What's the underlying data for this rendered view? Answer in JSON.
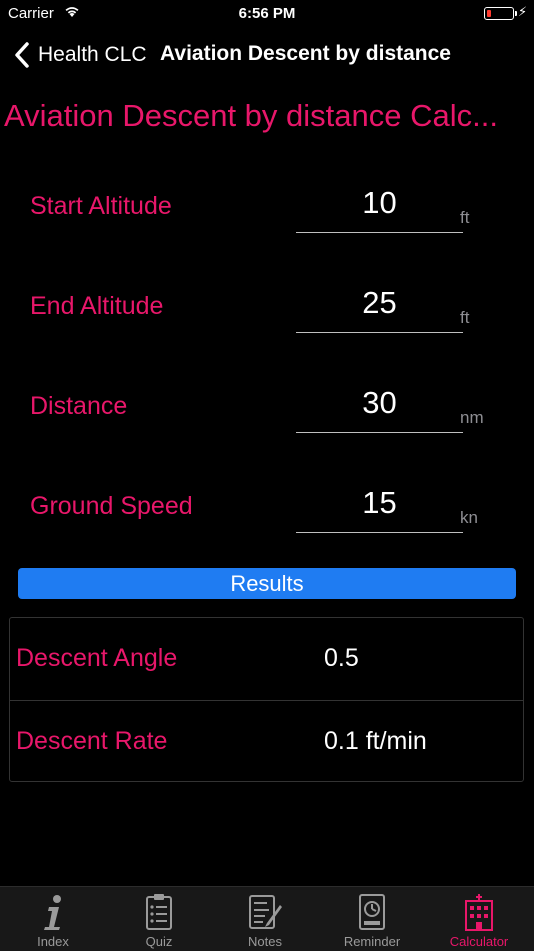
{
  "status_bar": {
    "carrier": "Carrier",
    "time": "6:56 PM",
    "charging_glyph": "⚡"
  },
  "nav": {
    "back_label": "Health CLC",
    "title": "Aviation Descent by distance"
  },
  "page_title": "Aviation Descent by distance Calc...",
  "fields": [
    {
      "label": "Start Altitude",
      "value": "10",
      "unit": "ft"
    },
    {
      "label": "End Altitude",
      "value": "25",
      "unit": "ft"
    },
    {
      "label": "Distance",
      "value": "30",
      "unit": "nm"
    },
    {
      "label": "Ground Speed",
      "value": "15",
      "unit": "kn"
    }
  ],
  "results_button": "Results",
  "results": [
    {
      "label": "Descent Angle",
      "value": "0.5"
    },
    {
      "label": "Descent Rate",
      "value": "0.1 ft/min"
    }
  ],
  "tabs": [
    {
      "label": "Index",
      "icon": "info-icon",
      "active": false
    },
    {
      "label": "Quiz",
      "icon": "clipboard-icon",
      "active": false
    },
    {
      "label": "Notes",
      "icon": "notes-icon",
      "active": false
    },
    {
      "label": "Reminder",
      "icon": "clock-icon",
      "active": false
    },
    {
      "label": "Calculator",
      "icon": "hospital-icon",
      "active": true
    }
  ],
  "colors": {
    "accent": "#e8176a",
    "button": "#1f7cf2",
    "background": "#000000"
  }
}
